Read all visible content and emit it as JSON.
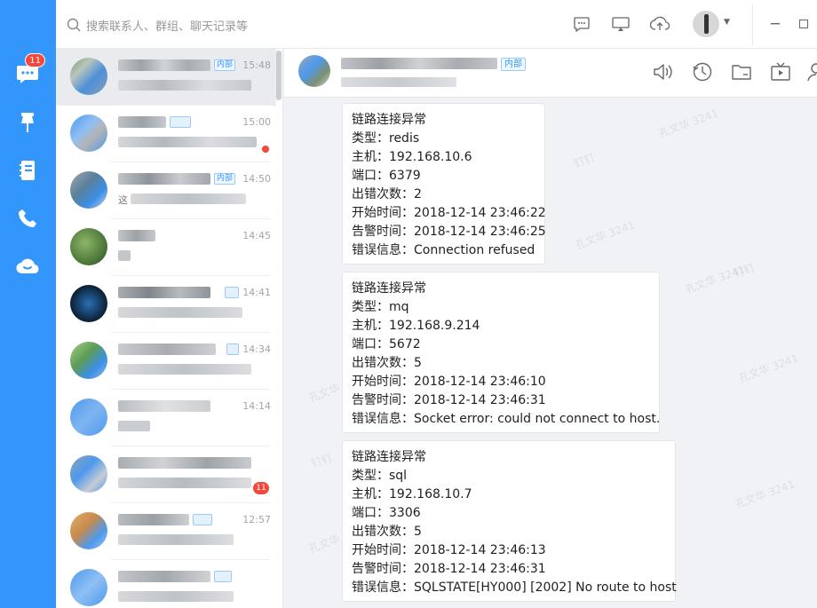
{
  "search": {
    "placeholder": "搜索联系人、群组、聊天记录等"
  },
  "rail": {
    "badge": "11"
  },
  "conversations": [
    {
      "time": "15:48",
      "tag": "内部"
    },
    {
      "time": "15:00",
      "tag": ""
    },
    {
      "time": "14:50",
      "tag": "内部",
      "preview_char": "这"
    },
    {
      "time": "14:45",
      "tag": ""
    },
    {
      "time": "14:41",
      "tag": ""
    },
    {
      "time": "14:34",
      "tag": ""
    },
    {
      "time": "14:14",
      "tag": ""
    },
    {
      "time": "",
      "tag": "",
      "badge": "11"
    },
    {
      "time": "12:57",
      "tag": ""
    },
    {
      "time": "",
      "tag": ""
    }
  ],
  "chat": {
    "tag": "内部"
  },
  "messages": [
    {
      "lines": [
        "链路连接异常",
        "类型：redis",
        "主机：192.168.10.6",
        "端口：6379",
        "出错次数：2",
        "开始时间：2018-12-14 23:46:22",
        "告警时间：2018-12-14 23:46:25",
        "错误信息：Connection refused"
      ]
    },
    {
      "lines": [
        "链路连接异常",
        "类型：mq",
        "主机：192.168.9.214",
        "端口：5672",
        "出错次数：5",
        "开始时间：2018-12-14 23:46:10",
        "告警时间：2018-12-14 23:46:31",
        "错误信息：Socket error: could not connect to host."
      ]
    },
    {
      "lines": [
        "链路连接异常",
        "类型：sql",
        "主机：192.168.10.7",
        "端口：3306",
        "出错次数：5",
        "开始时间：2018-12-14 23:46:13",
        "告警时间：2018-12-14 23:46:31",
        "错误信息：SQLSTATE[HY000] [2002] No route to host"
      ]
    }
  ],
  "watermarks": [
    "孔文华 3241",
    "钉钉"
  ]
}
